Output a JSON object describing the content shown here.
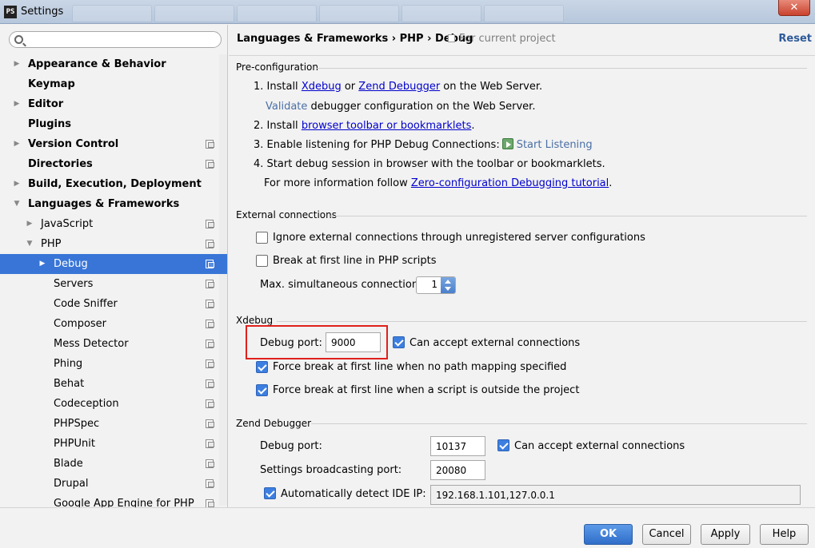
{
  "window": {
    "app_icon": "PS",
    "title": "Settings",
    "close_glyph": "✕"
  },
  "sidebar": {
    "search_placeholder": "",
    "items": [
      {
        "label": "Appearance & Behavior",
        "level": 0,
        "bold": true,
        "arrow": "right",
        "proj": false
      },
      {
        "label": "Keymap",
        "level": 0,
        "bold": true,
        "arrow": "none",
        "proj": false
      },
      {
        "label": "Editor",
        "level": 0,
        "bold": true,
        "arrow": "right",
        "proj": false
      },
      {
        "label": "Plugins",
        "level": 0,
        "bold": true,
        "arrow": "none",
        "proj": false
      },
      {
        "label": "Version Control",
        "level": 0,
        "bold": true,
        "arrow": "right",
        "proj": true
      },
      {
        "label": "Directories",
        "level": 0,
        "bold": true,
        "arrow": "none",
        "proj": true
      },
      {
        "label": "Build, Execution, Deployment",
        "level": 0,
        "bold": true,
        "arrow": "right",
        "proj": false
      },
      {
        "label": "Languages & Frameworks",
        "level": 0,
        "bold": true,
        "arrow": "down",
        "proj": false
      },
      {
        "label": "JavaScript",
        "level": 1,
        "bold": false,
        "arrow": "right",
        "proj": true
      },
      {
        "label": "PHP",
        "level": 1,
        "bold": false,
        "arrow": "down",
        "proj": true
      },
      {
        "label": "Debug",
        "level": 2,
        "bold": false,
        "arrow": "right",
        "proj": true,
        "selected": true
      },
      {
        "label": "Servers",
        "level": 2,
        "bold": false,
        "arrow": "none",
        "proj": true
      },
      {
        "label": "Code Sniffer",
        "level": 2,
        "bold": false,
        "arrow": "none",
        "proj": true
      },
      {
        "label": "Composer",
        "level": 2,
        "bold": false,
        "arrow": "none",
        "proj": true
      },
      {
        "label": "Mess Detector",
        "level": 2,
        "bold": false,
        "arrow": "none",
        "proj": true
      },
      {
        "label": "Phing",
        "level": 2,
        "bold": false,
        "arrow": "none",
        "proj": true
      },
      {
        "label": "Behat",
        "level": 2,
        "bold": false,
        "arrow": "none",
        "proj": true
      },
      {
        "label": "Codeception",
        "level": 2,
        "bold": false,
        "arrow": "none",
        "proj": true
      },
      {
        "label": "PHPSpec",
        "level": 2,
        "bold": false,
        "arrow": "none",
        "proj": true
      },
      {
        "label": "PHPUnit",
        "level": 2,
        "bold": false,
        "arrow": "none",
        "proj": true
      },
      {
        "label": "Blade",
        "level": 2,
        "bold": false,
        "arrow": "none",
        "proj": true
      },
      {
        "label": "Drupal",
        "level": 2,
        "bold": false,
        "arrow": "none",
        "proj": true
      },
      {
        "label": "Google App Engine for PHP",
        "level": 2,
        "bold": false,
        "arrow": "none",
        "proj": true
      }
    ]
  },
  "header": {
    "breadcrumb": "Languages & Frameworks › PHP › Debug",
    "scope": "For current project",
    "reset": "Reset"
  },
  "preconfig": {
    "title": "Pre-configuration",
    "step1_prefix": "1. Install ",
    "step1_link1": "Xdebug",
    "step1_mid": " or ",
    "step1_link2": "Zend Debugger",
    "step1_suffix": " on the Web Server.",
    "validate_link": "Validate",
    "validate_suffix": " debugger configuration on the Web Server.",
    "step2_prefix": "2. Install ",
    "step2_link": "browser toolbar or bookmarklets",
    "step2_suffix": ".",
    "step3_prefix": "3. Enable listening for PHP Debug Connections:",
    "step3_link": "Start Listening",
    "step4": "4. Start debug session in browser with the toolbar or bookmarklets.",
    "more_prefix": "For more information follow ",
    "more_link": "Zero-configuration Debugging tutorial",
    "more_suffix": "."
  },
  "external": {
    "title": "External connections",
    "ignore_label": "Ignore external connections through unregistered server configurations",
    "ignore_checked": false,
    "break_label": "Break at first line in PHP scripts",
    "break_checked": false,
    "max_label": "Max. simultaneous connections:",
    "max_value": "1"
  },
  "xdebug": {
    "title": "Xdebug",
    "port_label": "Debug port:",
    "port_value": "9000",
    "accept_label": "Can accept external connections",
    "accept_checked": true,
    "force_nopath_label": "Force break at first line when no path mapping specified",
    "force_nopath_checked": true,
    "force_outside_label": "Force break at first line when a script is outside the project",
    "force_outside_checked": true
  },
  "zend": {
    "title": "Zend Debugger",
    "port_label": "Debug port:",
    "port_value": "10137",
    "accept_label": "Can accept external connections",
    "accept_checked": true,
    "broadcast_label": "Settings broadcasting port:",
    "broadcast_value": "20080",
    "auto_ip_label": "Automatically detect IDE IP:",
    "auto_ip_checked": true,
    "ip_value": "192.168.1.101,127.0.0.1"
  },
  "footer": {
    "ok": "OK",
    "cancel": "Cancel",
    "apply": "Apply",
    "help": "Help"
  },
  "colors": {
    "selection": "#3875d7",
    "link": "#0000cc",
    "highlight": "#e0201c"
  }
}
